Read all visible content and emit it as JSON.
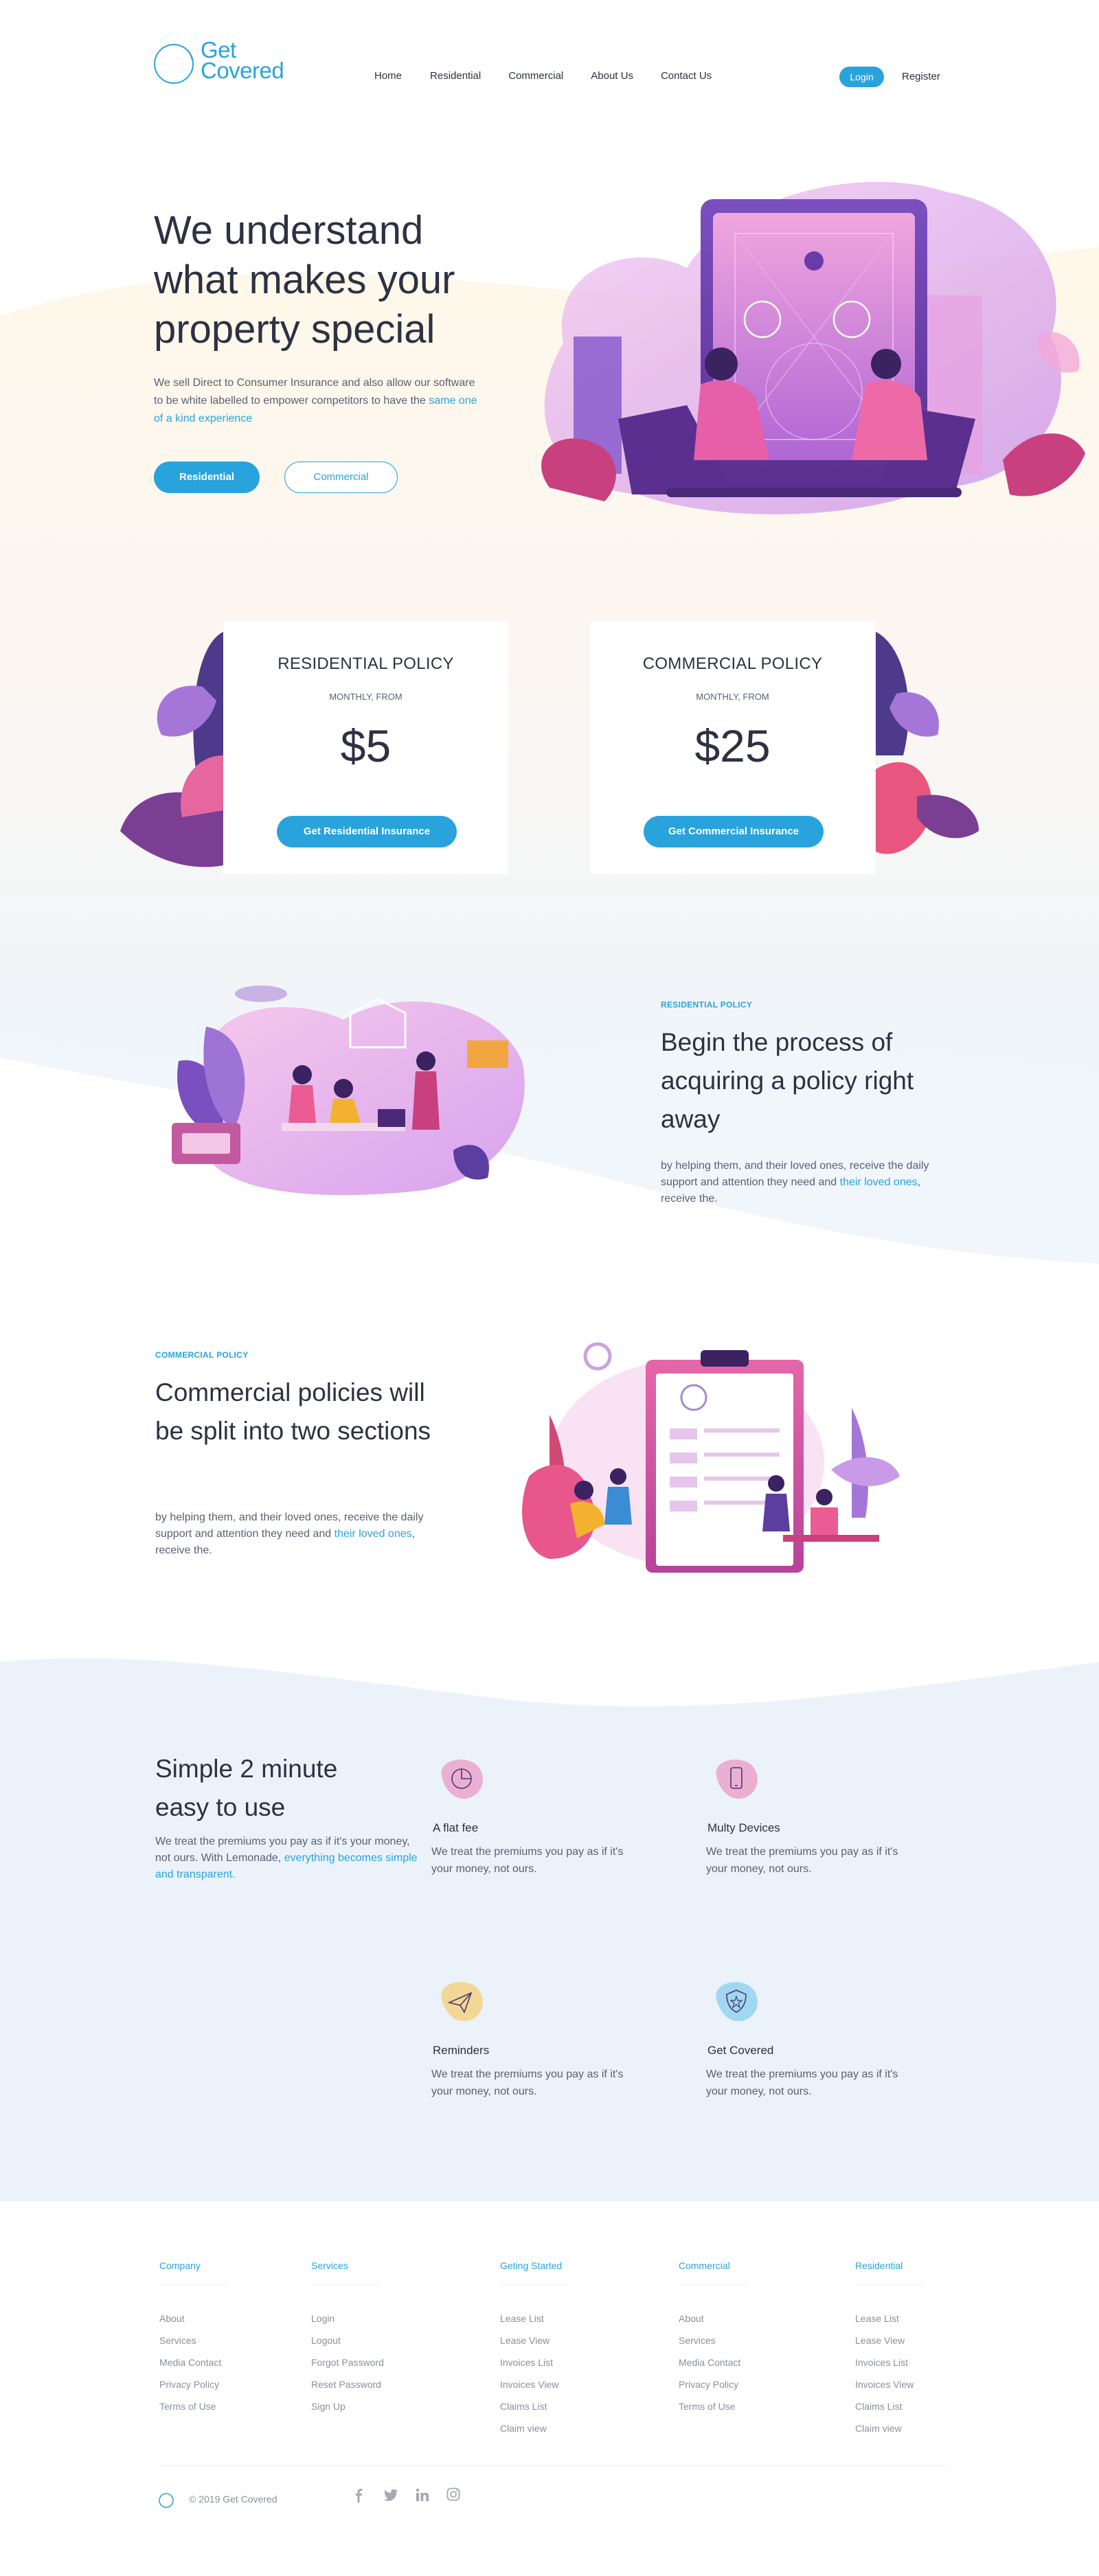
{
  "brand": {
    "logo_line1": "Get",
    "logo_line2": "Covered",
    "accent": "#29a3dc"
  },
  "nav": {
    "items": [
      "Home",
      "Residential",
      "Commercial",
      "About Us",
      "Contact Us"
    ],
    "login": "Login",
    "register": "Register"
  },
  "hero": {
    "title": "We understand what makes your property special",
    "desc": "We sell Direct to Consumer Insurance and also allow our software to be white labelled to empower competitors to have the",
    "desc_link": "same one of a kind experience",
    "btn_residential": "Residential",
    "btn_commercial": "Commercial"
  },
  "pricing": [
    {
      "title": "RESIDENTIAL POLICY",
      "sub": "MONTHLY, FROM",
      "price": "$5",
      "button": "Get Residential Insurance"
    },
    {
      "title": "COMMERCIAL POLICY",
      "sub": "MONTHLY, FROM",
      "price": "$25",
      "button": "Get Commercial Insurance"
    }
  ],
  "residential_section": {
    "eyebrow": "RESIDENTIAL POLICY",
    "title": "Begin the process of acquiring a policy right away",
    "text": "by helping them, and their loved ones, receive the daily support and attention they need and",
    "link": "their loved ones",
    "tail": ", receive the."
  },
  "commercial_section": {
    "eyebrow": "COMMERCIAL POLICY",
    "title": "Commercial policies will be split into two sections",
    "text": "by helping them, and their loved ones, receive the daily support and attention they need and",
    "link": "their loved ones",
    "tail": ", receive the."
  },
  "features": {
    "title": "Simple 2 minute easy to use",
    "text": "We treat the premiums you pay as if it's your money, not ours. With Lemonade,",
    "link": "everything becomes simple and transparent.",
    "items": [
      {
        "title": "A flat fee",
        "text": "We treat the premiums you pay as if it's your money, not ours.",
        "icon": "pie-chart-icon"
      },
      {
        "title": "Multy Devices",
        "text": "We treat the premiums you pay as if it's your money, not ours.",
        "icon": "phone-icon"
      },
      {
        "title": "Reminders",
        "text": "We treat the premiums you pay as if it's your money, not ours.",
        "icon": "paper-plane-icon"
      },
      {
        "title": "Get Covered",
        "text": "We treat the premiums you pay as if it's your money, not ours.",
        "icon": "shield-star-icon"
      }
    ]
  },
  "footer": {
    "columns": [
      {
        "head": "Company",
        "links": [
          "About",
          "Services",
          "Media Contact",
          "Privacy Policy",
          "Terms of Use"
        ]
      },
      {
        "head": "Services",
        "links": [
          "Login",
          "Logout",
          "Forgot Password",
          "Reset Password",
          "Sign Up"
        ]
      },
      {
        "head": "Geting Started",
        "links": [
          "Lease List",
          "Lease View",
          "Invoices List",
          "Invoices View",
          "Claims List",
          "Claim view"
        ]
      },
      {
        "head": "Commercial",
        "links": [
          "About",
          "Services",
          "Media Contact",
          "Privacy Policy",
          "Terms of Use"
        ]
      },
      {
        "head": "Residential",
        "links": [
          "Lease List",
          "Lease View",
          "Invoices List",
          "Invoices View",
          "Claims List",
          "Claim view"
        ]
      }
    ],
    "copyright": "© 2019 Get Covered"
  }
}
